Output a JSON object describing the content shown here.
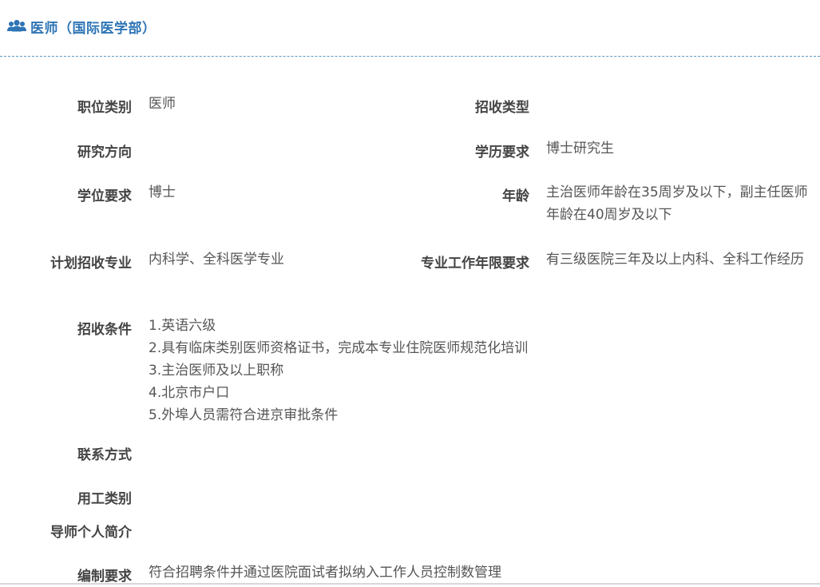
{
  "header": {
    "title": "医师（国际医学部）",
    "icon": "users-icon",
    "accent_color": "#2e75b5"
  },
  "fields": {
    "position_category": {
      "label": "职位类别",
      "value": "医师"
    },
    "recruit_type": {
      "label": "招收类型",
      "value": ""
    },
    "research_direction": {
      "label": "研究方向",
      "value": ""
    },
    "education_req": {
      "label": "学历要求",
      "value": "博士研究生"
    },
    "degree_req": {
      "label": "学位要求",
      "value": "博士"
    },
    "age": {
      "label": "年龄",
      "value": "主治医师年龄在35周岁及以下，副主任医师年龄在40周岁及以下"
    },
    "planned_major": {
      "label": "计划招收专业",
      "value": "内科学、全科医学专业"
    },
    "work_years_req": {
      "label": "专业工作年限要求",
      "value": "有三级医院三年及以上内科、全科工作经历"
    },
    "conditions": {
      "label": "招收条件",
      "items": [
        "1.英语六级",
        "2.具有临床类别医师资格证书，完成本专业住院医师规范化培训",
        "3.主治医师及以上职称",
        "4.北京市户口",
        "5.外埠人员需符合进京审批条件"
      ]
    },
    "contact": {
      "label": "联系方式",
      "value": ""
    },
    "employment_type": {
      "label": "用工类别",
      "value": ""
    },
    "mentor_intro": {
      "label": "导师个人简介",
      "value": ""
    },
    "staffing_req": {
      "label": "编制要求",
      "value": "符合招聘条件并通过医院面试者拟纳入工作人员控制数管理"
    }
  }
}
